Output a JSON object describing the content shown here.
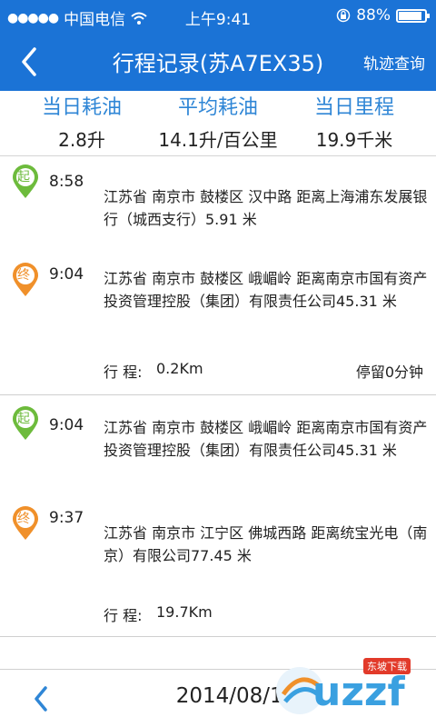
{
  "status_bar": {
    "carrier": "中国电信",
    "time": "上午9:41",
    "battery": "88%",
    "battery_level": 0.88
  },
  "nav": {
    "title": "行程记录(苏A7EX35)",
    "track_label": "轨迹查询"
  },
  "summary": [
    {
      "label": "当日耗油",
      "value": "2.8升"
    },
    {
      "label": "平均耗油",
      "value": "14.1升/百公里"
    },
    {
      "label": "当日里程",
      "value": "19.9千米"
    }
  ],
  "trips": [
    {
      "start": {
        "badge": "起",
        "time": "8:58",
        "address": "江苏省 南京市 鼓楼区 汉中路  距离上海浦东发展银行（城西支行）5.91 米"
      },
      "end": {
        "badge": "终",
        "time": "9:04",
        "address": "江苏省 南京市 鼓楼区 峨嵋岭  距离南京市国有资产投资管理控股（集团）有限责任公司45.31 米"
      },
      "distance_label": "行 程:",
      "distance": "0.2Km",
      "stay": "停留0分钟"
    },
    {
      "start": {
        "badge": "起",
        "time": "9:04",
        "address": "江苏省 南京市 鼓楼区 峨嵋岭  距离南京市国有资产投资管理控股（集团）有限责任公司45.31 米"
      },
      "end": {
        "badge": "终",
        "time": "9:37",
        "address": "江苏省 南京市 江宁区 佛城西路  距离统宝光电（南京）有限公司77.45 米"
      },
      "distance_label": "行 程:",
      "distance": "19.7Km",
      "stay": ""
    }
  ],
  "footer": {
    "date": "2014/08/13"
  },
  "watermark": {
    "text": "uzzf",
    "badge": "东坡下载"
  },
  "colors": {
    "primary": "#1b73d6",
    "label_blue": "#2f86d6",
    "start_green": "#6dbb3c",
    "end_orange": "#f0902a"
  }
}
